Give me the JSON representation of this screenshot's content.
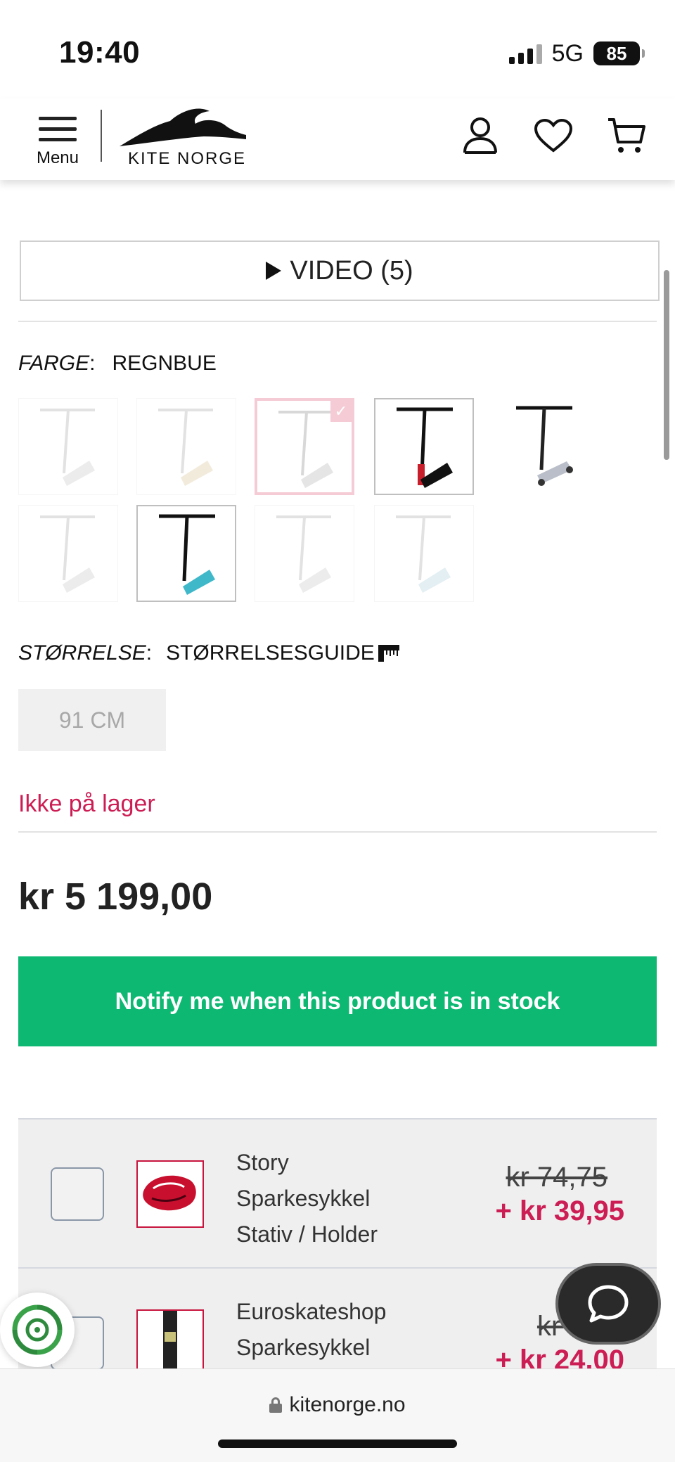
{
  "status_bar": {
    "time": "19:40",
    "network": "5G",
    "battery": "85"
  },
  "header": {
    "menu_label": "Menu",
    "logo_text": "KITE NORGE",
    "icons": [
      "account-icon",
      "heart-icon",
      "cart-icon"
    ]
  },
  "video_button": {
    "label": "VIDEO (5)"
  },
  "color": {
    "label": "FARGE",
    "value": "REGNBUE",
    "selected_index": 2,
    "swatch_count": 9
  },
  "size": {
    "label": "STØRRELSE",
    "guide_label": "STØRRELSESGUIDE",
    "options": [
      "91 CM"
    ]
  },
  "stock_status": "Ikke på lager",
  "price": "kr 5 199,00",
  "notify_button": "Notify me when this product is in stock",
  "upsell": [
    {
      "name_lines": [
        "Story",
        "Sparkesykkel",
        "Stativ / Holder"
      ],
      "old_price": "kr 74,75",
      "new_price": "+ kr 39,95"
    },
    {
      "name_lines": [
        "Euroskateshop",
        "Sparkesykkel"
      ],
      "old_price": "kr 74,",
      "new_price": "+ kr 24,00"
    }
  ],
  "browser": {
    "url": "kitenorge.no"
  },
  "colors": {
    "accent_green": "#0db873",
    "alert_red": "#cc1e55",
    "selected_swatch": "#f2bcc8"
  }
}
